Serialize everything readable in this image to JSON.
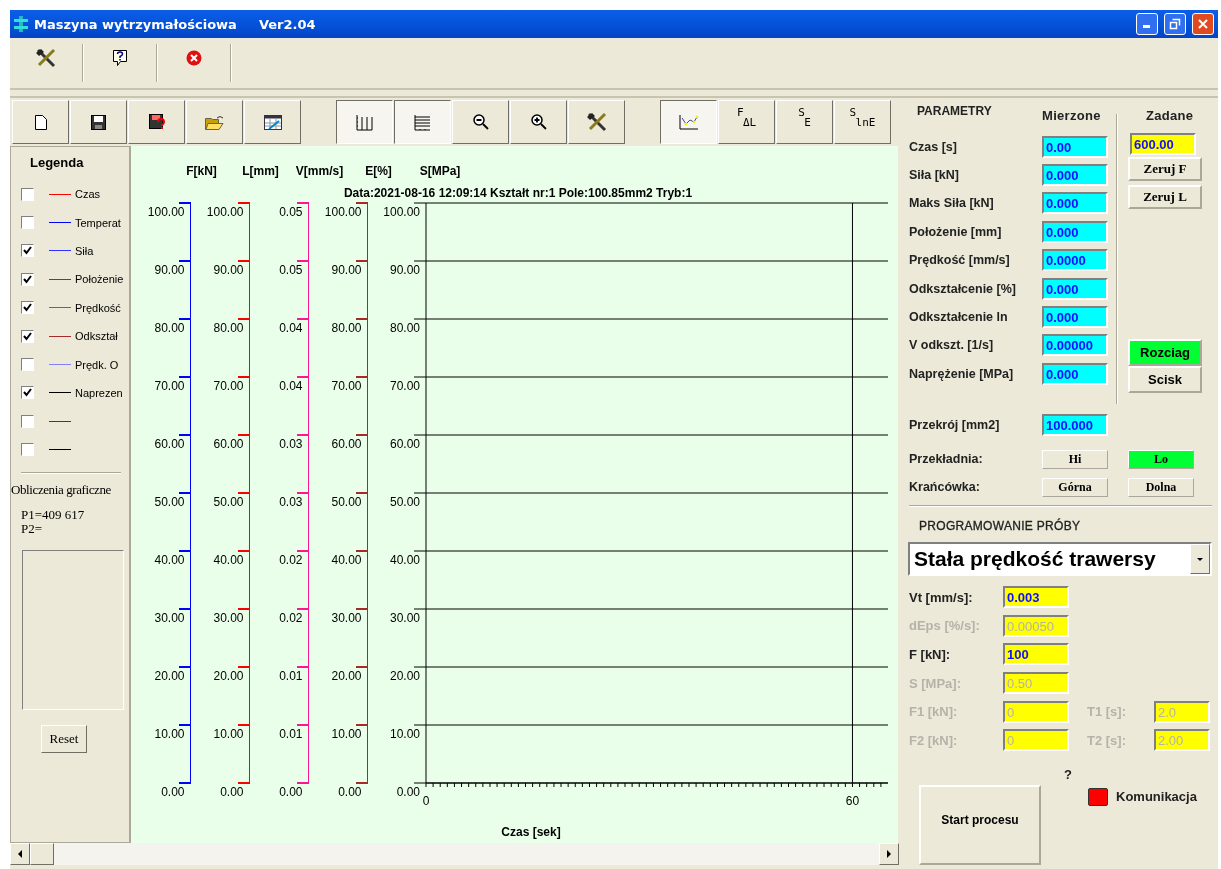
{
  "window": {
    "title": "Maszyna wytrzymałościowa",
    "version": "Ver2.04"
  },
  "chart_toolbar": {
    "groups": [
      [
        {
          "kind": "icon",
          "pressed": false
        },
        {
          "kind": "icon",
          "pressed": false
        },
        {
          "kind": "icon",
          "pressed": false
        },
        {
          "kind": "icon",
          "pressed": false
        },
        {
          "kind": "icon",
          "pressed": false
        }
      ],
      [
        {
          "kind": "icon",
          "pressed": true
        },
        {
          "kind": "icon",
          "pressed": true
        },
        {
          "kind": "icon",
          "pressed": false
        },
        {
          "kind": "icon",
          "pressed": false
        },
        {
          "kind": "icon",
          "pressed": false
        }
      ],
      [
        {
          "kind": "icon",
          "pressed": true
        },
        {
          "kind": "text",
          "top": "F",
          "bottom": "ΔL",
          "pressed": false
        },
        {
          "kind": "text",
          "top": "S",
          "bottom": "E",
          "pressed": false
        },
        {
          "kind": "text",
          "top": "S",
          "bottom": "lnE",
          "pressed": false
        }
      ]
    ]
  },
  "legend": {
    "title": "Legenda",
    "items": [
      {
        "label": "Czas",
        "checked": false,
        "color": "#ff0000"
      },
      {
        "label": "Temperat",
        "checked": false,
        "color": "#0000ff"
      },
      {
        "label": "Siła",
        "checked": true,
        "color": "#3030ff"
      },
      {
        "label": "Położenie",
        "checked": true,
        "color": "#ff0000"
      },
      {
        "label": "Prędkość",
        "checked": true,
        "color": "#ff1493"
      },
      {
        "label": "Odkształ",
        "checked": true,
        "color": "#a52a2a"
      },
      {
        "label": "Prędk. O",
        "checked": false,
        "color": "#8080ff"
      },
      {
        "label": "Naprezen",
        "checked": true,
        "color": "#000000"
      },
      {
        "checked": false,
        "color": "#404040"
      },
      {
        "checked": false,
        "color": "#000000"
      }
    ]
  },
  "graphic_calc": {
    "title": "Obliczenia graficzne",
    "lines": [
      "P1=409 617",
      "P2="
    ],
    "button": "Reset"
  },
  "chart": {
    "y_axes": [
      {
        "unit": "F[kN]",
        "color": "#0000ff",
        "ticks": [
          "100.00",
          "90.00",
          "80.00",
          "70.00",
          "60.00",
          "50.00",
          "40.00",
          "30.00",
          "20.00",
          "10.00",
          "0.00"
        ]
      },
      {
        "unit": "L[mm]",
        "color": "#ff0000",
        "ticks": [
          "100.00",
          "90.00",
          "80.00",
          "70.00",
          "60.00",
          "50.00",
          "40.00",
          "30.00",
          "20.00",
          "10.00",
          "0.00"
        ]
      },
      {
        "unit": "V[mm/s]",
        "color": "#ff1493",
        "ticks": [
          "0.05",
          "0.05",
          "0.04",
          "0.04",
          "0.03",
          "0.03",
          "0.02",
          "0.02",
          "0.01",
          "0.01",
          "0.00"
        ]
      },
      {
        "unit": "E[%]",
        "color": "#a52a2a",
        "ticks": [
          "100.00",
          "90.00",
          "80.00",
          "70.00",
          "60.00",
          "50.00",
          "40.00",
          "30.00",
          "20.00",
          "10.00",
          "0.00"
        ]
      }
    ],
    "chart_data": {
      "type": "line",
      "grid": true,
      "title": "Data:2021-08-16 12:09:14 Kształt nr:1 Pole:100.85mm2 Tryb:1",
      "xlabel": "Czas [sek]",
      "ylabel": "S[MPa]",
      "xlim": [
        0,
        65
      ],
      "xticks": [
        0,
        60
      ],
      "ylim": [
        0,
        100
      ],
      "yticks": [
        {
          "value": 100,
          "label": "100.00"
        },
        {
          "value": 90,
          "label": "90.00"
        },
        {
          "value": 80,
          "label": "80.00"
        },
        {
          "value": 70,
          "label": "70.00"
        },
        {
          "value": 60,
          "label": "60.00"
        },
        {
          "value": 50,
          "label": "50.00"
        },
        {
          "value": 40,
          "label": "40.00"
        },
        {
          "value": 30,
          "label": "30.00"
        },
        {
          "value": 20,
          "label": "20.00"
        },
        {
          "value": 10,
          "label": "10.00"
        },
        {
          "value": 0,
          "label": "0.00"
        }
      ]
    }
  },
  "params": {
    "title": "PARAMETRY",
    "measured_header": "Mierzone",
    "set_header": "Zadane",
    "rows": [
      {
        "label": "Czas [s]",
        "value": "0.00"
      },
      {
        "label": "Siła [kN]",
        "value": "0.000"
      },
      {
        "label": "Maks Siła [kN]",
        "value": "0.000"
      },
      {
        "label": "Położenie [mm]",
        "value": "0.000"
      },
      {
        "label": "Prędkość [mm/s]",
        "value": "0.0000"
      },
      {
        "label": "Odkształcenie [%]",
        "value": "0.000"
      },
      {
        "label": "Odkształcenie ln",
        "value": "0.000"
      },
      {
        "label": "V odkszt. [1/s]",
        "value": "0.00000"
      },
      {
        "label": "Naprężenie [MPa]",
        "value": "0.000"
      }
    ],
    "set_value": "600.00",
    "zero_buttons": [
      "Zeruj F",
      "Zeruj L"
    ],
    "modes": [
      {
        "label": "Rozciag",
        "selected": true
      },
      {
        "label": "Scisk",
        "selected": false
      }
    ],
    "cross_section": {
      "label": "Przekrój [mm2]",
      "value": "100.000"
    },
    "gear": {
      "label": "Przekładnia:",
      "options": [
        {
          "label": "Hi",
          "selected": false
        },
        {
          "label": "Lo",
          "selected": true
        }
      ]
    },
    "limit_switch": {
      "label": "Krańcówka:",
      "buttons": [
        "Górna",
        "Dolna"
      ]
    }
  },
  "program": {
    "title": "PROGRAMOWANIE PRÓBY",
    "mode": "Stała prędkość trawersy",
    "fields": [
      {
        "label": "Vt [mm/s]:",
        "value": "0.003",
        "disabled": false
      },
      {
        "label": "dEps [%/s]:",
        "value": "0.00050",
        "disabled": true
      },
      {
        "label": "F [kN]:",
        "value": "100",
        "disabled": false
      },
      {
        "label": "S [MPa]:",
        "value": "0.50",
        "disabled": true
      }
    ],
    "pairs": [
      [
        {
          "label": "F1 [kN]:",
          "value": "0",
          "disabled": true
        },
        {
          "label": "T1 [s]:",
          "value": "2.0",
          "disabled": true
        }
      ],
      [
        {
          "label": "F2 [kN]:",
          "value": "0",
          "disabled": true
        },
        {
          "label": "T2 [s]:",
          "value": "2.00",
          "disabled": true
        }
      ]
    ],
    "status_mark": "?",
    "connection": {
      "label": "Komunikacja",
      "connected": false
    },
    "start_button": "Start procesu"
  }
}
